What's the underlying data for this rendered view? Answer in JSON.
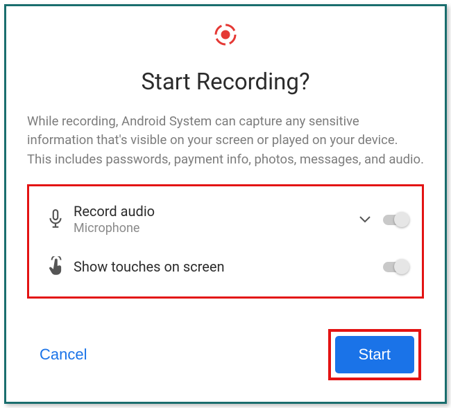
{
  "dialog": {
    "title": "Start Recording?",
    "description": "While recording, Android System can capture any sensitive information that's visible on your screen or played on your device. This includes passwords, payment info, photos, messages, and audio."
  },
  "options": {
    "record_audio": {
      "title": "Record audio",
      "subtitle": "Microphone",
      "enabled": false
    },
    "show_touches": {
      "title": "Show touches on screen",
      "enabled": false
    }
  },
  "actions": {
    "cancel_label": "Cancel",
    "start_label": "Start"
  },
  "colors": {
    "accent": "#1a73e8",
    "highlight_box": "#e31313",
    "frame": "#1a6e6e",
    "record_dot": "#e53935"
  }
}
